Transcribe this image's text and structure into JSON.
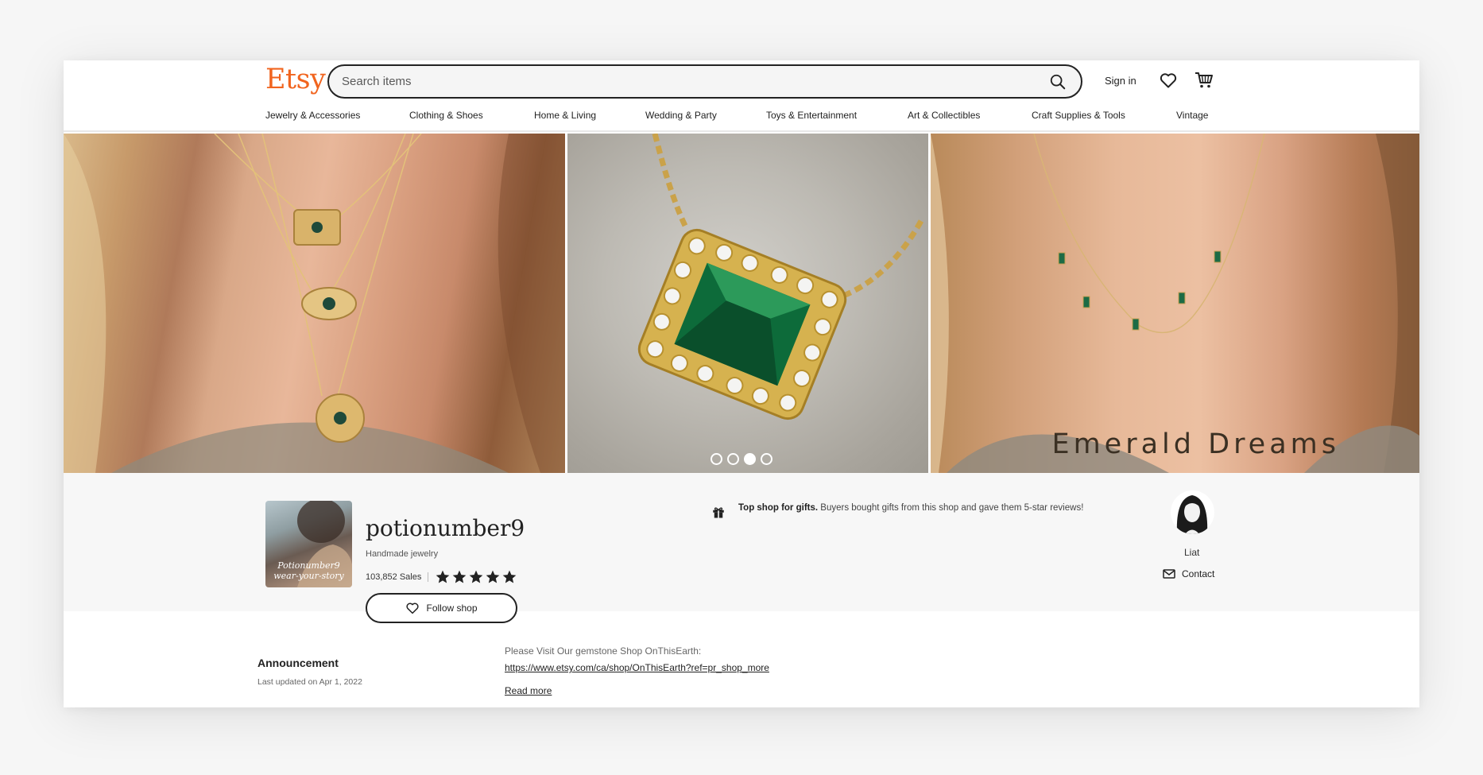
{
  "header": {
    "logo": "Etsy",
    "search_placeholder": "Search items",
    "sign_in": "Sign in"
  },
  "nav": {
    "items": [
      "Jewelry & Accessories",
      "Clothing & Shoes",
      "Home & Living",
      "Wedding & Party",
      "Toys & Entertainment",
      "Art & Collectibles",
      "Craft Supplies & Tools",
      "Vintage"
    ]
  },
  "hero": {
    "caption": "Emerald Dreams",
    "slide_count": 4,
    "active_slide": 3
  },
  "shop": {
    "name": "potionumber9",
    "tagline": "Handmade jewelry",
    "sales": "103,852 Sales",
    "rating": 5,
    "follow_label": "Follow shop",
    "avatar_text": "Potionumber9 wear-your-story",
    "gift_title": "Top shop for gifts.",
    "gift_text": "Buyers bought gifts from this shop and gave them 5-star reviews!"
  },
  "owner": {
    "name": "Liat",
    "contact_label": "Contact"
  },
  "announcement": {
    "title": "Announcement",
    "date": "Last updated on Apr 1, 2022",
    "body": "Please Visit Our gemstone Shop OnThisEarth:",
    "link": "https://www.etsy.com/ca/shop/OnThisEarth?ref=pr_shop_more",
    "read_more": "Read more"
  },
  "colors": {
    "brand": "#f1641e",
    "text": "#222222",
    "page_background": "#f6f6f6",
    "shop_section_background": "#f7f7f7"
  }
}
